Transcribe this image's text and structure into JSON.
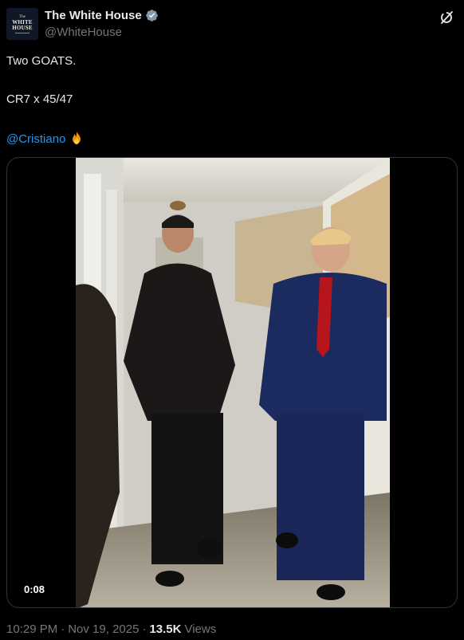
{
  "tweet": {
    "author": {
      "display_name": "The White House",
      "handle": "@WhiteHouse",
      "verified": true,
      "avatar": {
        "line_top": "The",
        "line_1": "WHITE",
        "line_2": "HOUSE"
      }
    },
    "text_lines": [
      "Two GOATS.",
      "CR7 x 45/47"
    ],
    "mention": "@Cristiano",
    "emoji": "fire-emoji",
    "media": {
      "type": "video",
      "duration": "0:08"
    },
    "time": "10:29 PM",
    "date": "Nov 19, 2025",
    "views_count": "13.5K",
    "views_label": "Views"
  },
  "icons": {
    "verified": "verified-badge-icon",
    "grok": "grok-icon"
  },
  "colors": {
    "background": "#000000",
    "text": "#e7e9ea",
    "secondary": "#71767b",
    "link": "#1d9bf0",
    "border": "#2f3336"
  }
}
